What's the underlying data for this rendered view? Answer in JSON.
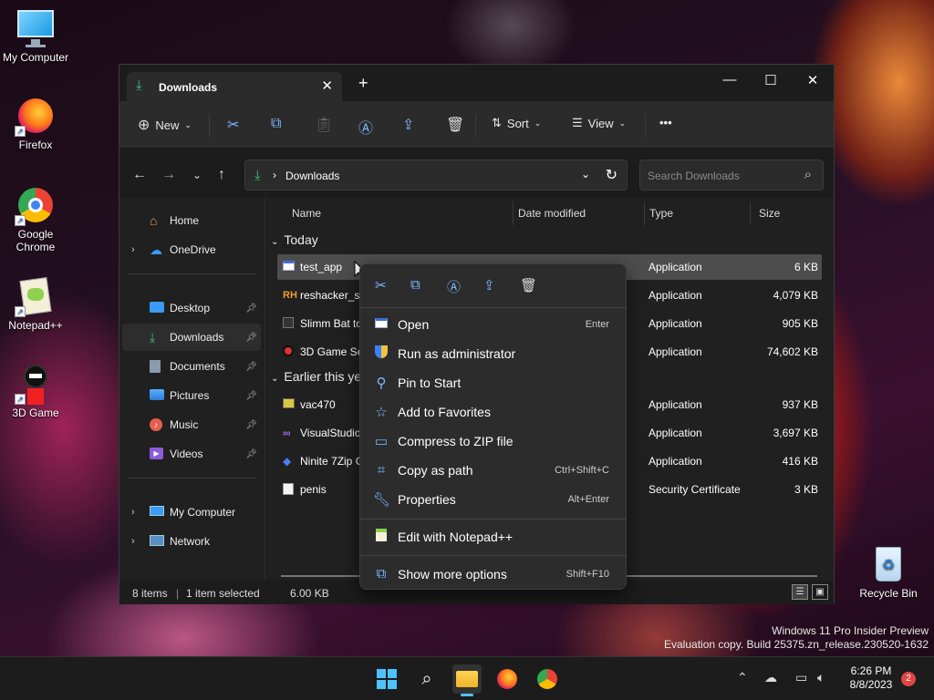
{
  "desktop": {
    "icons": [
      {
        "label": "My Computer",
        "icon": "monitor-icon"
      },
      {
        "label": "Firefox",
        "icon": "firefox-icon"
      },
      {
        "label": "Google Chrome",
        "icon": "chrome-icon"
      },
      {
        "label": "Notepad++",
        "icon": "notepadpp-icon"
      },
      {
        "label": "3D Game",
        "icon": "3d-game-icon"
      },
      {
        "label": "Recycle Bin",
        "icon": "recycle-bin-icon"
      }
    ],
    "watermark_line1": "Windows 11 Pro Insider Preview",
    "watermark_line2": "Evaluation copy. Build 25375.zn_release.230520-1632"
  },
  "window": {
    "tab_title": "Downloads",
    "toolbar": {
      "new_label": "New",
      "sort_label": "Sort",
      "view_label": "View",
      "more_label": "•••"
    },
    "address": {
      "path": "Downloads"
    },
    "search": {
      "placeholder": "Search Downloads"
    },
    "nav": {
      "home": "Home",
      "onedrive": "OneDrive",
      "quick": [
        "Desktop",
        "Downloads",
        "Documents",
        "Pictures",
        "Music",
        "Videos"
      ],
      "mycomputer": "My Computer",
      "network": "Network"
    },
    "columns": {
      "name": "Name",
      "date": "Date modified",
      "type": "Type",
      "size": "Size"
    },
    "groups": {
      "today": "Today",
      "earlier": "Earlier this year"
    },
    "files": [
      {
        "name": "test_app",
        "type": "Application",
        "size": "6 KB"
      },
      {
        "name": "reshacker_setup",
        "type": "Application",
        "size": "4,079 KB"
      },
      {
        "name": "Slimm Bat to Exe",
        "type": "Application",
        "size": "905 KB"
      },
      {
        "name": "3D Game Setup",
        "type": "Application",
        "size": "74,602 KB"
      },
      {
        "name": "vac470",
        "type": "Application",
        "size": "937 KB"
      },
      {
        "name": "VisualStudioSetup",
        "type": "Application",
        "size": "3,697 KB"
      },
      {
        "name": "Ninite 7Zip Chrome",
        "type": "Application",
        "size": "416 KB"
      },
      {
        "name": "penis",
        "type": "Security Certificate",
        "size": "3 KB"
      }
    ],
    "status": {
      "items": "8 items",
      "selected": "1 item selected",
      "size": "6.00 KB"
    }
  },
  "context_menu": {
    "items": [
      {
        "label": "Open",
        "key": "Enter",
        "icon": "open-icon"
      },
      {
        "label": "Run as administrator",
        "key": "",
        "icon": "shield-icon"
      },
      {
        "label": "Pin to Start",
        "key": "",
        "icon": "pin-icon"
      },
      {
        "label": "Add to Favorites",
        "key": "",
        "icon": "star-icon"
      },
      {
        "label": "Compress to ZIP file",
        "key": "",
        "icon": "zip-icon"
      },
      {
        "label": "Copy as path",
        "key": "Ctrl+Shift+C",
        "icon": "path-icon"
      },
      {
        "label": "Properties",
        "key": "Alt+Enter",
        "icon": "wrench-icon"
      },
      {
        "label": "Edit with Notepad++",
        "key": "",
        "icon": "notepadpp-icon"
      },
      {
        "label": "Show more options",
        "key": "Shift+F10",
        "icon": "more-options-icon"
      }
    ]
  },
  "taskbar": {
    "time": "6:26 PM",
    "date": "8/8/2023",
    "notifications": "2"
  },
  "colors": {
    "accent": "#7ab8ff",
    "downloads_green": "#3ec07a",
    "window_bg": "#202020",
    "menu_bg": "#2c2c2c",
    "selected_row": "#4d4d4d",
    "badge": "#e04545"
  }
}
